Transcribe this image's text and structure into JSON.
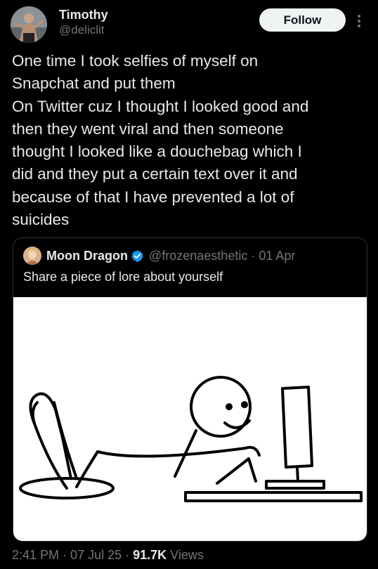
{
  "author": {
    "display_name": "Timothy",
    "handle": "@deliclit"
  },
  "follow_button": {
    "label": "Follow"
  },
  "tweet": {
    "text": "One time I took selfies of myself on\nSnapchat and put them\nOn Twitter cuz I thought I looked good and\nthen they went viral and then someone\nthought I looked like a douchebag which I\ndid and they put a certain text over it and\nbecause of that I have prevented a lot of\nsuicides"
  },
  "quoted_tweet": {
    "display_name": "Moon Dragon",
    "verified_icon": "verified-badge-icon",
    "handle": "@frozenaesthetic",
    "date": "01 Apr",
    "text": "Share a piece of lore about yourself",
    "image_subject": "stick figure at a computer desk"
  },
  "footer": {
    "time": "2:41 PM",
    "date": "07 Jul 25",
    "views_count": "91.7K",
    "views_label": "Views"
  },
  "colors": {
    "background": "#000000",
    "primary_text": "#e7e9ea",
    "secondary_text": "#71767b",
    "border": "#2f3336",
    "verified": "#1d9bf0",
    "follow_bg": "#eff3f4"
  }
}
